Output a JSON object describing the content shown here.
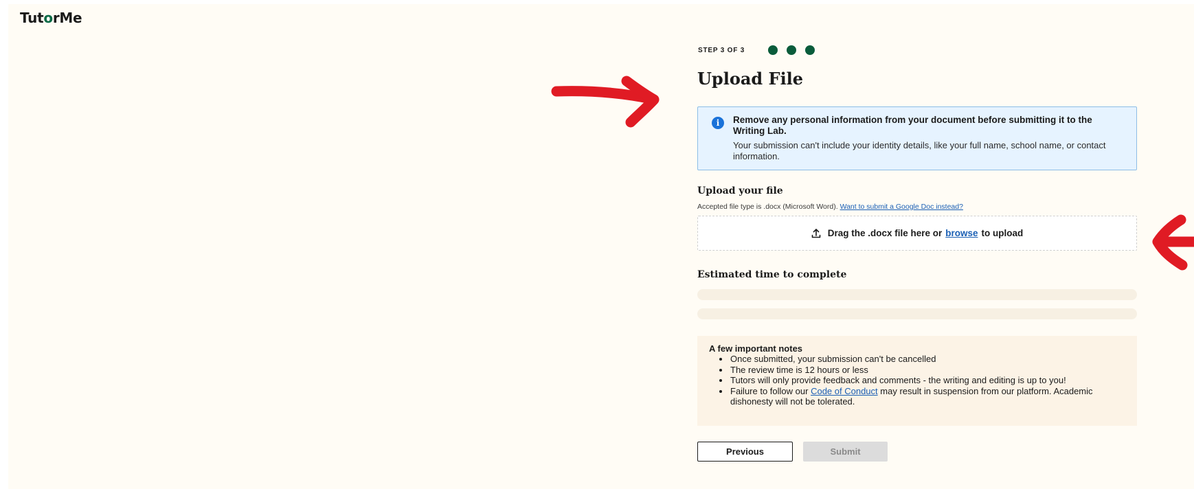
{
  "logo": {
    "part1": "Tut",
    "part2": "o",
    "part3": "r",
    "part4": "Me"
  },
  "stepper": {
    "label": "STEP 3 OF 3",
    "total_steps": 3,
    "completed_steps": 3,
    "dot_color": "#0a5c3b"
  },
  "page_title": "Upload File",
  "info_banner": {
    "icon": "info-icon",
    "heading": "Remove any personal information from your document before submitting it to the Writing Lab.",
    "body": "Your submission can't include your identity details, like your full name, school name, or contact information."
  },
  "upload": {
    "heading": "Upload your file",
    "accepted_text": "Accepted file type is .docx (Microsoft Word).",
    "google_doc_link": "Want to submit a Google Doc instead?",
    "drop_prefix": "Drag the .docx file here or",
    "browse_link": "browse",
    "drop_suffix": "to upload",
    "icon": "upload-icon"
  },
  "estimate": {
    "heading": "Estimated time to complete"
  },
  "notes": {
    "heading": "A few important notes",
    "items": [
      "Once submitted, your submission can't be cancelled",
      "The review time is 12 hours or less",
      "Tutors will only provide feedback and comments - the writing and editing is up to you!"
    ],
    "last_item_prefix": "Failure to follow our",
    "last_item_link": "Code of Conduct",
    "last_item_suffix": "may result in suspension from our platform. Academic dishonesty will not be tolerated."
  },
  "buttons": {
    "previous": "Previous",
    "submit": "Submit"
  },
  "colors": {
    "brand_green": "#0a6b47",
    "annotation_red": "#e01b24",
    "link_blue": "#1a5fb4"
  }
}
